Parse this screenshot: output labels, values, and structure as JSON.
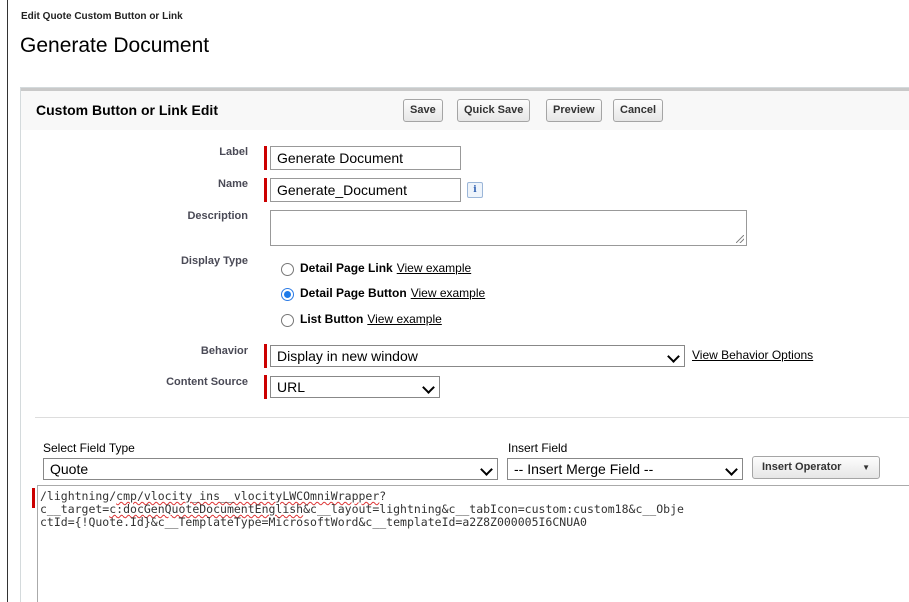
{
  "page": {
    "subtitle": "Edit Quote Custom Button or Link",
    "title": "Generate Document"
  },
  "panel": {
    "title": "Custom Button or Link Edit",
    "buttons": {
      "save": "Save",
      "quick_save": "Quick Save",
      "preview": "Preview",
      "cancel": "Cancel"
    }
  },
  "form": {
    "label": {
      "label": "Label",
      "value": "Generate Document"
    },
    "name": {
      "label": "Name",
      "value": "Generate_Document",
      "info_icon": "i"
    },
    "description": {
      "label": "Description",
      "value": ""
    },
    "display_type": {
      "label": "Display Type",
      "options": [
        {
          "label": "Detail Page Link",
          "link": "View example",
          "selected": false
        },
        {
          "label": "Detail Page Button",
          "link": "View example",
          "selected": true
        },
        {
          "label": "List Button",
          "link": "View example",
          "selected": false
        }
      ]
    },
    "behavior": {
      "label": "Behavior",
      "value": "Display in new window",
      "link": "View Behavior Options"
    },
    "content_source": {
      "label": "Content Source",
      "value": "URL"
    }
  },
  "formula": {
    "field_type_label": "Select Field Type",
    "field_type_value": "Quote",
    "insert_field_label": "Insert Field",
    "insert_field_value": "-- Insert Merge Field --",
    "insert_operator": "Insert Operator",
    "code_lines": [
      {
        "pre": "/lightning/",
        "spell": "cmp/vlocity_ins__vlocityLWCOmniWrapper",
        "post": "?"
      },
      {
        "pre": "c__target=",
        "spell": "c:docGenQuoteDocumentEnglish",
        "post": "&c__layout=lightning&c__tabIcon=custom:custom18&c__Obje"
      },
      {
        "pre": "ctId={!Quote.Id}&c__TemplateType=MicrosoftWord&c__templateId=a2Z8Z000005I6CNUA0",
        "spell": "",
        "post": ""
      }
    ]
  }
}
